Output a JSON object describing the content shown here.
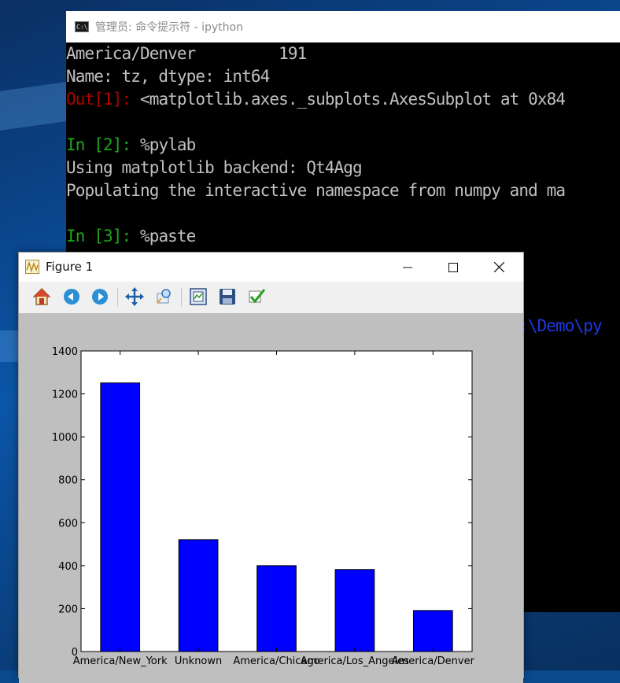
{
  "console": {
    "title": "管理员: 命令提示符 - ipython",
    "lines": [
      {
        "text": "America/Denver         191"
      },
      {
        "text": "Name: tz, dtype: int64"
      },
      {
        "prompt": "Out[1]: ",
        "text": "<matplotlib.axes._subplots.AxesSubplot at 0x84"
      },
      {
        "text": ""
      },
      {
        "prompt": "In [2]: ",
        "text": "%pylab"
      },
      {
        "text": "Using matplotlib backend: Qt4Agg"
      },
      {
        "text": "Populating the interactive namespace from numpy and ma"
      },
      {
        "text": ""
      },
      {
        "prompt": "In [3]: ",
        "text": "%paste"
      }
    ],
    "partial_path": ":\\Demo\\py"
  },
  "figure": {
    "title": "Figure 1",
    "toolbar_icons": [
      "home-icon",
      "back-icon",
      "forward-icon",
      "pan-icon",
      "zoom-icon",
      "subplots-icon",
      "save-icon",
      "edit-axis-icon"
    ],
    "colors": {
      "bar": "#0000ff",
      "plot_background": "#bfbfbf"
    }
  },
  "chart_data": {
    "type": "bar",
    "categories": [
      "America/New_York",
      "Unknown",
      "America/Chicago",
      "America/Los_Angeles",
      "America/Denver"
    ],
    "values": [
      1251,
      521,
      400,
      382,
      191
    ],
    "ylim": [
      0,
      1400
    ],
    "yticks": [
      "0",
      "200",
      "400",
      "600",
      "800",
      "1000",
      "1200",
      "1400"
    ],
    "grid": false,
    "title": "",
    "xlabel": "",
    "ylabel": ""
  }
}
